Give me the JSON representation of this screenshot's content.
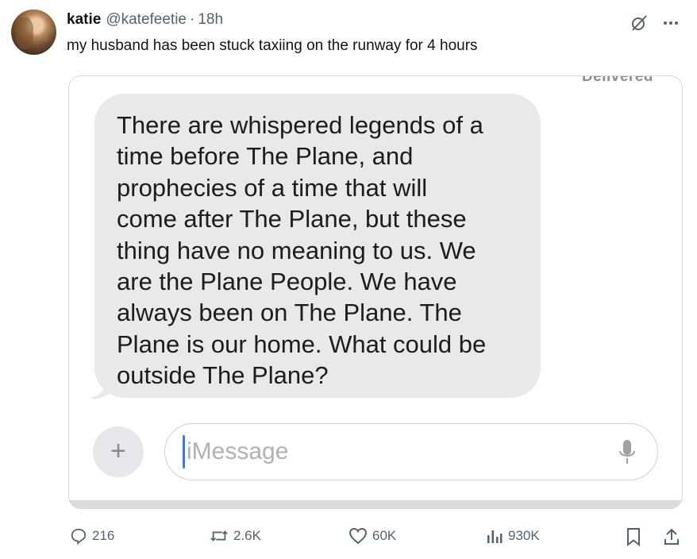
{
  "tweet": {
    "author_name": "katie",
    "handle": "@katefeetie",
    "separator": "·",
    "time": "18h",
    "text": "my husband has been stuck taxiing on the runway for 4 hours"
  },
  "screenshot": {
    "status": "Delivered",
    "message": "There are whispered legends of a\ntime before The Plane, and\nprophecies of a time that will\ncome after The Plane, but these\nthing have no meaning to us. We\nare the Plane People. We have\nalways been on The Plane. The\nPlane is our home. What could be\noutside The Plane?",
    "plus_label": "+",
    "input_placeholder": "iMessage"
  },
  "actions": {
    "replies": "216",
    "reposts": "2.6K",
    "likes": "60K",
    "views": "930K"
  }
}
